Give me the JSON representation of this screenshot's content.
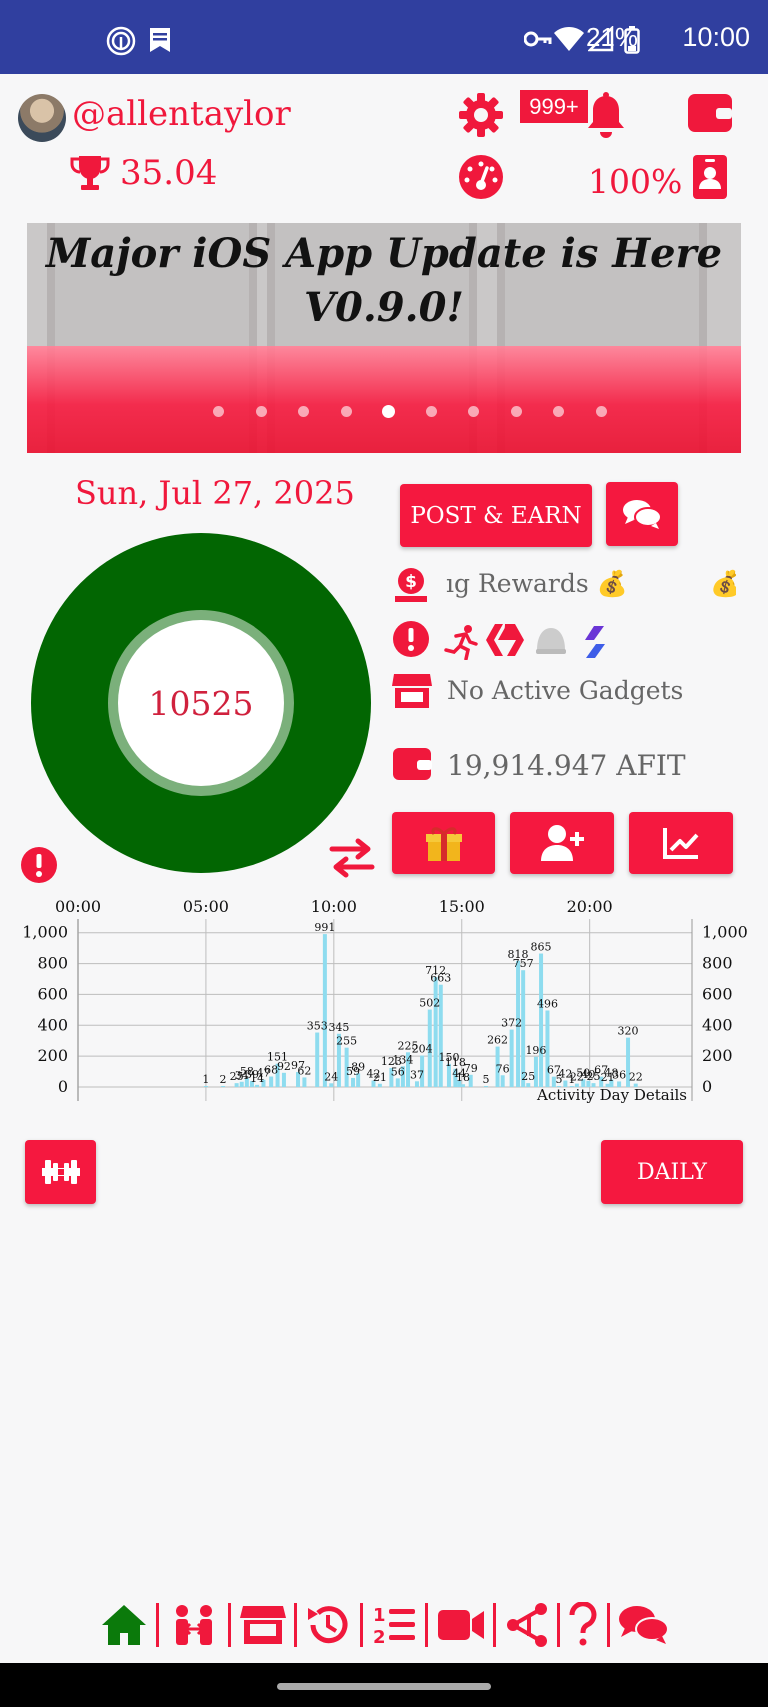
{
  "status_bar": {
    "battery": "21%",
    "time": "10:00"
  },
  "header": {
    "username": "@allentaylor",
    "score": "35.04",
    "notification_badge": "999+",
    "percent": "100%"
  },
  "banner": {
    "title_line1": "Major iOS App Update is Here",
    "title_line2": "V0.9.0!",
    "slide_count": 10,
    "active_slide": 5
  },
  "main": {
    "date": "Sun, Jul 27, 2025",
    "steps": "10525",
    "post_earn_label": "POST & EARN",
    "rewards_text": "ıg Rewards 💰",
    "rewards_text_2": "💰",
    "gadgets_text": "No Active Gadgets",
    "balance": "19,914.947 AFIT"
  },
  "chart_data": {
    "type": "bar",
    "title": "Activity Day Details",
    "x_tick_labels": [
      "00:00",
      "05:00",
      "10:00",
      "15:00",
      "20:00"
    ],
    "y_tick_labels": [
      "1,000",
      "800",
      "600",
      "400",
      "200",
      "0"
    ],
    "ylim": [
      0,
      1050
    ],
    "x_range": [
      0,
      24
    ],
    "bar_color": "#8edcef",
    "bars": [
      {
        "x": 5.0,
        "y": 1,
        "label": "1"
      },
      {
        "x": 5.67,
        "y": 2,
        "label": "2"
      },
      {
        "x": 6.2,
        "y": 25,
        "label": "25"
      },
      {
        "x": 6.4,
        "y": 34,
        "label": "34"
      },
      {
        "x": 6.6,
        "y": 58,
        "label": "58"
      },
      {
        "x": 6.8,
        "y": 39,
        "label": "39"
      },
      {
        "x": 7.0,
        "y": 14,
        "label": "14"
      },
      {
        "x": 7.25,
        "y": 47,
        "label": "47"
      },
      {
        "x": 7.55,
        "y": 68,
        "label": "68"
      },
      {
        "x": 7.8,
        "y": 151,
        "label": "151"
      },
      {
        "x": 8.05,
        "y": 92,
        "label": "92"
      },
      {
        "x": 8.6,
        "y": 97,
        "label": "97"
      },
      {
        "x": 8.85,
        "y": 62,
        "label": "62"
      },
      {
        "x": 9.35,
        "y": 353,
        "label": "353"
      },
      {
        "x": 9.65,
        "y": 991,
        "label": "991"
      },
      {
        "x": 9.9,
        "y": 24,
        "label": "24"
      },
      {
        "x": 10.2,
        "y": 345,
        "label": "345"
      },
      {
        "x": 10.5,
        "y": 255,
        "label": "255"
      },
      {
        "x": 10.75,
        "y": 59,
        "label": "59"
      },
      {
        "x": 10.95,
        "y": 89,
        "label": "89"
      },
      {
        "x": 11.55,
        "y": 42,
        "label": "42"
      },
      {
        "x": 11.8,
        "y": 21,
        "label": "21"
      },
      {
        "x": 12.25,
        "y": 123,
        "label": "123"
      },
      {
        "x": 12.5,
        "y": 56,
        "label": "56"
      },
      {
        "x": 12.7,
        "y": 134,
        "label": "134"
      },
      {
        "x": 12.9,
        "y": 225,
        "label": "225"
      },
      {
        "x": 13.25,
        "y": 37,
        "label": "37"
      },
      {
        "x": 13.45,
        "y": 204,
        "label": "204"
      },
      {
        "x": 13.75,
        "y": 502,
        "label": "502"
      },
      {
        "x": 13.98,
        "y": 712,
        "label": "712"
      },
      {
        "x": 14.18,
        "y": 663,
        "label": "663"
      },
      {
        "x": 14.5,
        "y": 150,
        "label": "150"
      },
      {
        "x": 14.75,
        "y": 118,
        "label": "118"
      },
      {
        "x": 14.9,
        "y": 44,
        "label": "44"
      },
      {
        "x": 15.05,
        "y": 18,
        "label": "18"
      },
      {
        "x": 15.35,
        "y": 79,
        "label": "79"
      },
      {
        "x": 15.95,
        "y": 5,
        "label": "5"
      },
      {
        "x": 16.4,
        "y": 262,
        "label": "262"
      },
      {
        "x": 16.6,
        "y": 76,
        "label": "76"
      },
      {
        "x": 16.95,
        "y": 372,
        "label": "372"
      },
      {
        "x": 17.2,
        "y": 818,
        "label": "818"
      },
      {
        "x": 17.4,
        "y": 757,
        "label": "757"
      },
      {
        "x": 17.6,
        "y": 25,
        "label": "25"
      },
      {
        "x": 17.9,
        "y": 196,
        "label": "196"
      },
      {
        "x": 18.1,
        "y": 865,
        "label": "865"
      },
      {
        "x": 18.35,
        "y": 496,
        "label": "496"
      },
      {
        "x": 18.6,
        "y": 67,
        "label": "67"
      },
      {
        "x": 18.8,
        "y": 5,
        "label": "5"
      },
      {
        "x": 19.05,
        "y": 42,
        "label": "42"
      },
      {
        "x": 19.3,
        "y": 1,
        "label": "1"
      },
      {
        "x": 19.5,
        "y": 22,
        "label": "22"
      },
      {
        "x": 19.75,
        "y": 50,
        "label": "50"
      },
      {
        "x": 19.95,
        "y": 40,
        "label": "40"
      },
      {
        "x": 20.15,
        "y": 25,
        "label": "25"
      },
      {
        "x": 20.45,
        "y": 67,
        "label": "67"
      },
      {
        "x": 20.7,
        "y": 21,
        "label": "21"
      },
      {
        "x": 20.85,
        "y": 48,
        "label": "48"
      },
      {
        "x": 21.15,
        "y": 36,
        "label": "36"
      },
      {
        "x": 21.5,
        "y": 320,
        "label": "320"
      },
      {
        "x": 21.8,
        "y": 22,
        "label": "22"
      }
    ]
  },
  "footer": {
    "daily_label": "DAILY"
  },
  "colors": {
    "brand_red": "#f5183f",
    "status_blue": "#303f9f",
    "donut_green": "#026602",
    "nav_home_green": "#0b7a0b"
  },
  "nav_icons": [
    "home-icon",
    "tokens-icon",
    "shop-icon",
    "history-icon",
    "leaderboard-icon",
    "video-icon",
    "share-icon",
    "help-icon",
    "chat-icon"
  ]
}
